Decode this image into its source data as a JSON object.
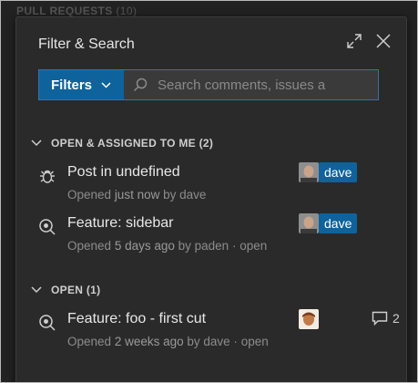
{
  "background": {
    "header": "PULL REQUESTS",
    "count": "(10)"
  },
  "panel": {
    "title": "Filter & Search",
    "filters_label": "Filters",
    "search_placeholder": "Search comments, issues a"
  },
  "sections": [
    {
      "label": "OPEN & ASSIGNED TO ME (2)",
      "items": [
        {
          "title": "Post in undefined",
          "opened": "Opened",
          "time": "just now",
          "by": "by dave",
          "state": "",
          "assignee": "dave",
          "icon": "bug-icon"
        },
        {
          "title": "Feature: sidebar",
          "opened": "Opened",
          "time": "5 days ago",
          "by": "by paden ·",
          "state": "open",
          "assignee": "dave",
          "icon": "search-issue-icon"
        }
      ]
    },
    {
      "label": "OPEN (1)",
      "items": [
        {
          "title": "Feature: foo - first cut",
          "opened": "Opened",
          "time": "2 weeks ago",
          "by": "by dave ·",
          "state": "open",
          "comment_count": "2",
          "icon": "search-issue-icon"
        }
      ]
    }
  ],
  "colors": {
    "accent": "#0e639c",
    "panel_bg": "#2a2a2a",
    "frame_bg": "#222222"
  }
}
